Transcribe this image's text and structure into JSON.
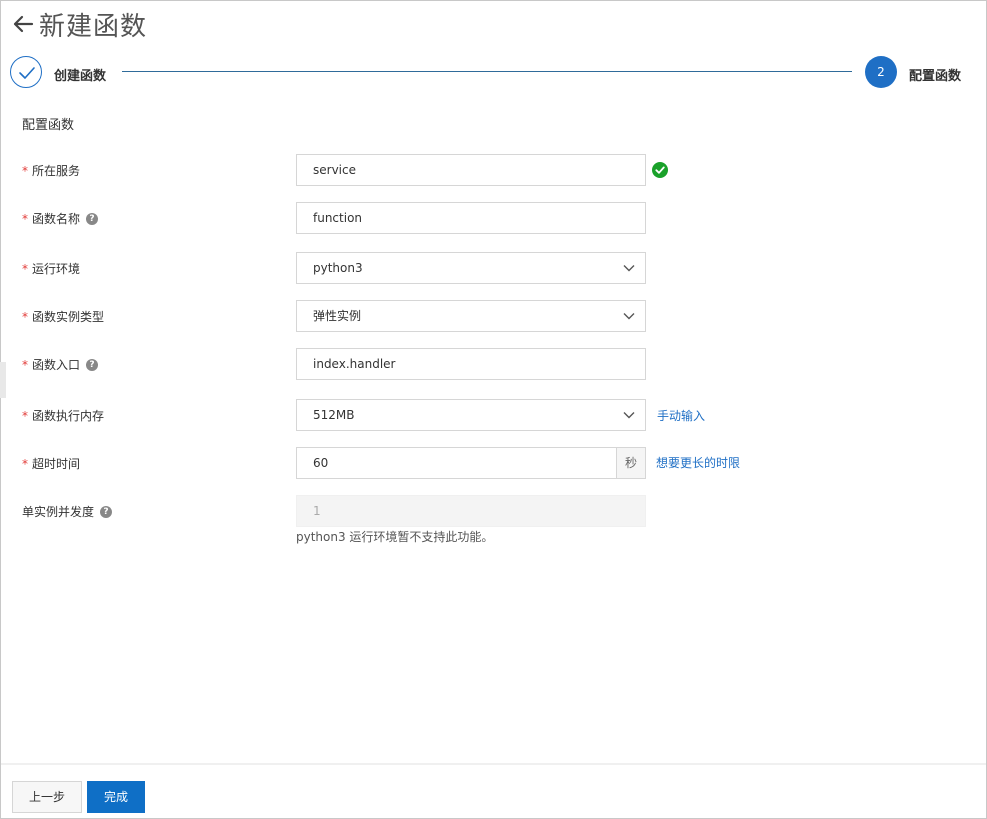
{
  "page": {
    "title": "新建函数"
  },
  "steps": [
    {
      "label": "创建函数",
      "status": "done"
    },
    {
      "number": "2",
      "label": "配置函数",
      "status": "active"
    }
  ],
  "section_title": "配置函数",
  "form": {
    "service": {
      "label": "所在服务",
      "value": "service"
    },
    "name": {
      "label": "函数名称",
      "value": "function"
    },
    "runtime": {
      "label": "运行环境",
      "value": "python3"
    },
    "instance_type": {
      "label": "函数实例类型",
      "value": "弹性实例"
    },
    "handler": {
      "label": "函数入口",
      "value": "index.handler"
    },
    "memory": {
      "label": "函数执行内存",
      "value": "512MB",
      "link": "手动输入"
    },
    "timeout": {
      "label": "超时时间",
      "value": "60",
      "unit": "秒",
      "link": "想要更长的时限"
    },
    "concurrency": {
      "label": "单实例并发度",
      "value": "1",
      "hint": "python3 运行环境暂不支持此功能。"
    }
  },
  "buttons": {
    "prev": "上一步",
    "done": "完成"
  },
  "colors": {
    "accent": "#1f6fc5",
    "required": "#e23c39",
    "success": "#1aa12a"
  }
}
